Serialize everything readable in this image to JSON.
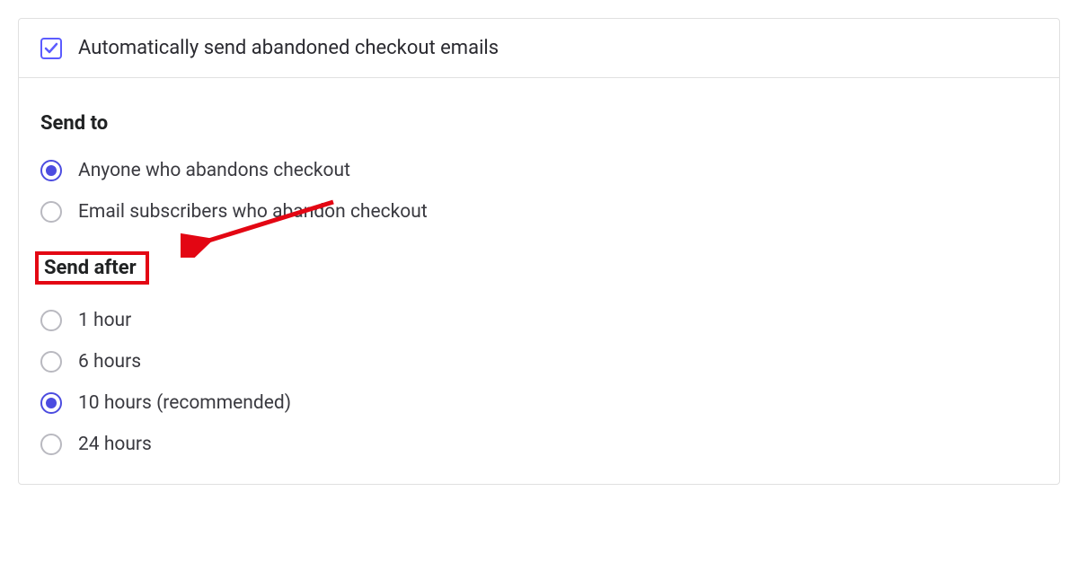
{
  "settings": {
    "auto_send": {
      "checked": true,
      "label": "Automatically send abandoned checkout emails"
    }
  },
  "send_to": {
    "heading": "Send to",
    "options": [
      {
        "label": "Anyone who abandons checkout",
        "selected": true
      },
      {
        "label": "Email subscribers who abandon checkout",
        "selected": false
      }
    ]
  },
  "send_after": {
    "heading": "Send after",
    "options": [
      {
        "label": "1 hour",
        "selected": false
      },
      {
        "label": "6 hours",
        "selected": false
      },
      {
        "label": "10 hours (recommended)",
        "selected": true
      },
      {
        "label": "24 hours",
        "selected": false
      }
    ]
  },
  "annotation": {
    "highlight_color": "#e30613",
    "arrow_color": "#e30613"
  }
}
